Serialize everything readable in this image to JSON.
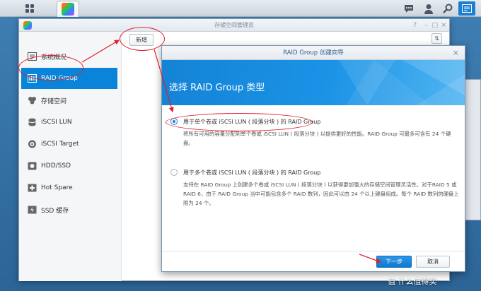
{
  "main_window": {
    "title": "存储空间管理员",
    "toolbar": {
      "create_label": "新增"
    }
  },
  "sidebar": {
    "items": [
      {
        "label": "系统概况",
        "icon": "overview-icon"
      },
      {
        "label": "RAID Group",
        "icon": "raid-icon"
      },
      {
        "label": "存储空间",
        "icon": "volume-icon"
      },
      {
        "label": "iSCSI LUN",
        "icon": "lun-icon"
      },
      {
        "label": "iSCSI Target",
        "icon": "target-icon"
      },
      {
        "label": "HDD/SSD",
        "icon": "disk-icon"
      },
      {
        "label": "Hot Spare",
        "icon": "hotspare-icon"
      },
      {
        "label": "SSD 缓存",
        "icon": "ssd-cache-icon"
      }
    ],
    "active_index": 1
  },
  "wizard": {
    "title": "RAID Group 创建向导",
    "heading": "选择 RAID Group 类型",
    "options": [
      {
        "label": "用于单个卷或 iSCSI LUN ( 段落分块 ) 的 RAID Group",
        "description": "将所有可用的容量分配到单个卷或 iSCSI LUN ( 段落分块 ) 以提供更好的性能。RAID Group 可最多可含有 24 个硬盘。",
        "selected": true
      },
      {
        "label": "用于多个卷或 iSCSI LUN ( 段落分块 ) 的 RAID Group",
        "description": "支持在 RAID Group 上创建多个卷或 iSCSI LUN ( 段落分块 ) 以获得更加强大的存储空间管理灵活性。对于RAID 5 或 RAID 6，由于 RAID Group 当中可能包含多个 RAID 数列，因此可以由 24 个以上硬盘组成。每个 RAID 数列的硬盘上限为 24 个。",
        "selected": false
      }
    ],
    "next_label": "下一步",
    "cancel_label": "取消"
  },
  "watermark": "值 什么值得买",
  "colors": {
    "accent": "#0a84d8",
    "annotation": "#e11d2a"
  }
}
